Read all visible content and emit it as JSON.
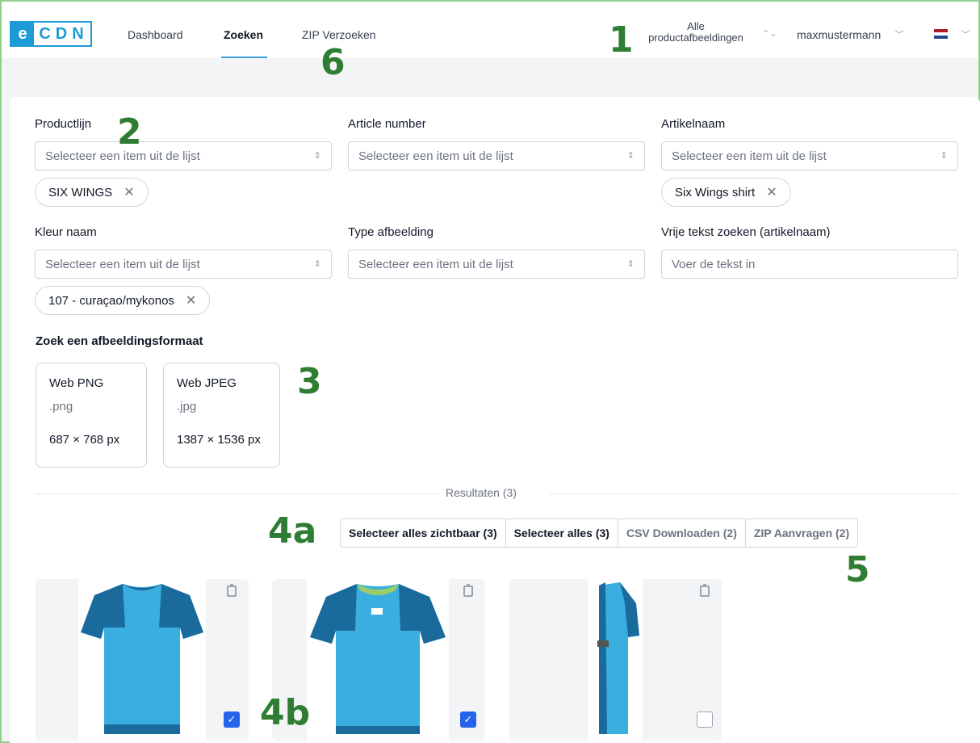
{
  "nav": {
    "logo_e": "e",
    "logo_cdn": "CDN",
    "items": [
      {
        "label": "Dashboard"
      },
      {
        "label": "Zoeken"
      },
      {
        "label": "ZIP Verzoeken"
      }
    ],
    "assets_select": "Alle productafbeeldingen",
    "user": "maxmustermann",
    "language_flag": "netherlands-flag"
  },
  "filters": {
    "productlijn": {
      "label": "Productlijn",
      "placeholder": "Selecteer een item uit de lijst",
      "chip": "SIX WINGS"
    },
    "article_number": {
      "label": "Article number",
      "placeholder": "Selecteer een item uit de lijst"
    },
    "artikelnaam": {
      "label": "Artikelnaam",
      "placeholder": "Selecteer een item uit de lijst",
      "chip": "Six Wings shirt"
    },
    "kleur_naam": {
      "label": "Kleur naam",
      "placeholder": "Selecteer een item uit de lijst",
      "chip": "107 - curaçao/mykonos"
    },
    "type_afbeelding": {
      "label": "Type afbeelding",
      "placeholder": "Selecteer een item uit de lijst"
    },
    "vrije_tekst": {
      "label": "Vrije tekst zoeken (artikelnaam)",
      "placeholder": "Voer de tekst in"
    }
  },
  "formats": {
    "title": "Zoek een afbeeldingsformaat",
    "items": [
      {
        "name": "Web PNG",
        "ext": ".png",
        "dim": "687 × 768 px"
      },
      {
        "name": "Web JPEG",
        "ext": ".jpg",
        "dim": "1387 × 1536 px"
      }
    ]
  },
  "results": {
    "label": "Resultaten (3)",
    "buttons": {
      "select_visible": "Selecteer alles zichtbaar (3)",
      "select_all": "Selecteer alles (3)",
      "csv": "CSV Downloaden (2)",
      "zip": "ZIP Aanvragen (2)"
    },
    "items": [
      {
        "checked": true
      },
      {
        "checked": true
      },
      {
        "checked": false
      }
    ]
  },
  "annotations": {
    "a1": "1",
    "a2": "2",
    "a3": "3",
    "a4a": "4a",
    "a4b": "4b",
    "a5": "5",
    "a6": "6"
  },
  "colors": {
    "accent": "#1d9bd6",
    "checkbox": "#2563eb",
    "shirt_main": "#3aaedf",
    "shirt_dark": "#1a6b9c",
    "annotation": "#2e7d32"
  }
}
